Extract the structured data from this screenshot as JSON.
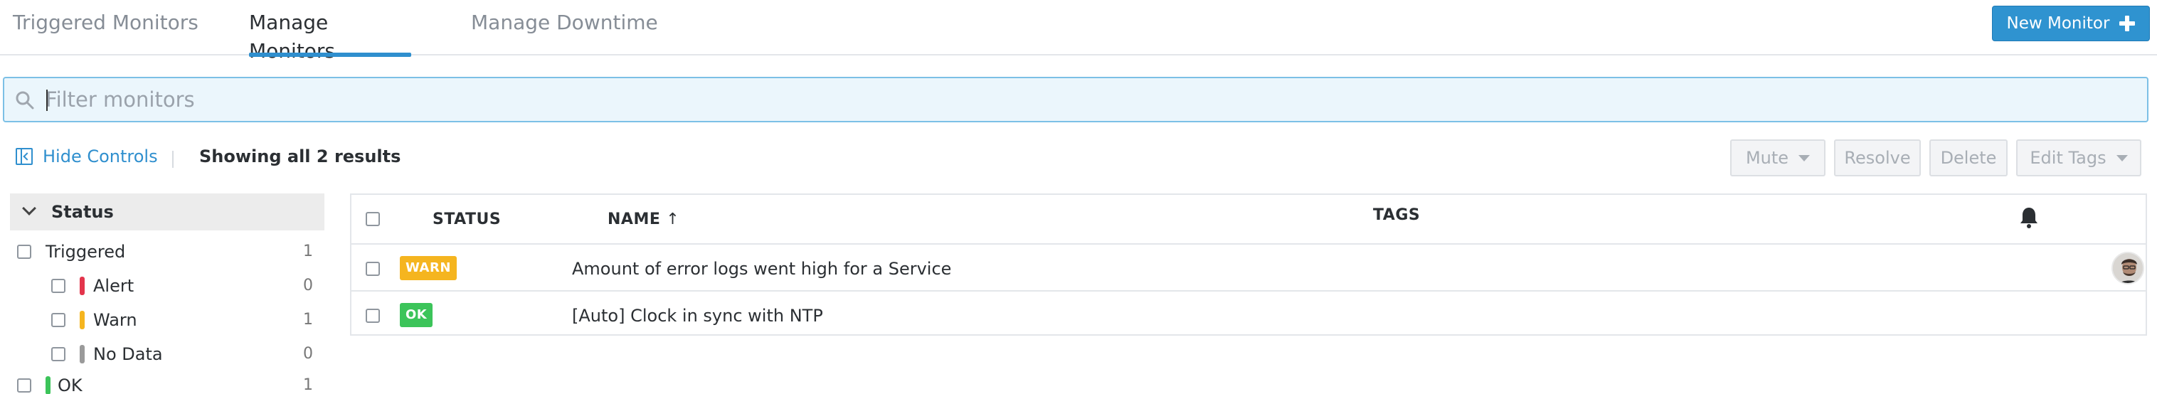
{
  "tabs": [
    {
      "label": "Triggered Monitors"
    },
    {
      "label": "Manage Monitors"
    },
    {
      "label": "Manage Downtime"
    }
  ],
  "new_monitor_label": "New Monitor",
  "search": {
    "placeholder": "Filter monitors",
    "value": ""
  },
  "controls": {
    "hide_controls_label": "Hide Controls",
    "showing_label": "Showing all 2 results"
  },
  "actions": {
    "mute": "Mute",
    "resolve": "Resolve",
    "delete": "Delete",
    "edit_tags": "Edit Tags"
  },
  "facets": {
    "title": "Status",
    "items": [
      {
        "label": "Triggered",
        "count": "1",
        "color": ""
      },
      {
        "label": "Alert",
        "count": "0",
        "color": "#e3354c"
      },
      {
        "label": "Warn",
        "count": "1",
        "color": "#f5b51f"
      },
      {
        "label": "No Data",
        "count": "0",
        "color": "#9a9a9a"
      },
      {
        "label": "OK",
        "count": "1",
        "color": "#3cc45a"
      }
    ]
  },
  "table": {
    "columns": {
      "status": "STATUS",
      "name": "NAME",
      "sort_arrow": "↑",
      "tags": "TAGS"
    },
    "rows": [
      {
        "status": "WARN",
        "status_color": "#f5b51f",
        "name": "Amount of error logs went high for a Service"
      },
      {
        "status": "OK",
        "status_color": "#3cc45a",
        "name": "[Auto] Clock in sync with NTP"
      }
    ]
  },
  "colors": {
    "accent": "#2f93d0"
  }
}
